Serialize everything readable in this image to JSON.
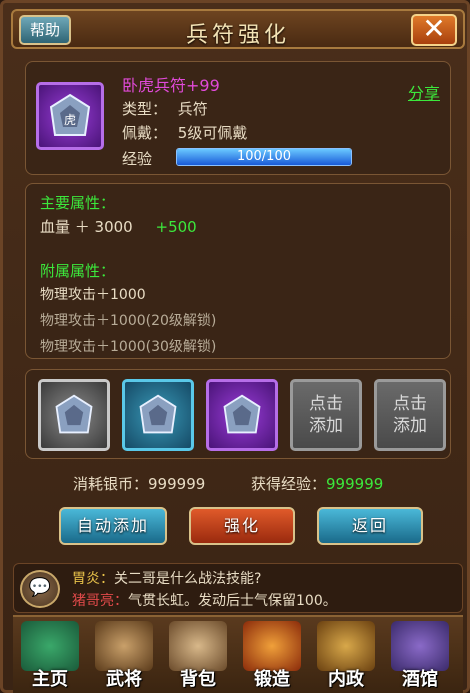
{
  "header": {
    "title": "兵符强化",
    "help_label": "帮助",
    "close_label": "✕"
  },
  "item": {
    "name": "卧虎兵符+99",
    "share_label": "分享",
    "type_label": "类型：",
    "type_value": "兵符",
    "wear_label": "佩戴：",
    "wear_value": "5级可佩戴",
    "exp_label": "经验",
    "exp_text": "100/100",
    "exp_progress": 1.0
  },
  "attributes": {
    "main_title": "主要属性：",
    "main_line": "血量 ＋ 3000",
    "main_bonus": "+500",
    "sub_title": "附属属性：",
    "sub_lines": [
      "物理攻击＋1000",
      "物理攻击＋1000(20级解锁)",
      "物理攻击＋1000(30级解锁)"
    ]
  },
  "materials": {
    "slots": [
      {
        "rarity": "grey"
      },
      {
        "rarity": "blue"
      },
      {
        "rarity": "purple"
      },
      {
        "rarity": "empty",
        "label_1": "点击",
        "label_2": "添加"
      },
      {
        "rarity": "empty",
        "label_1": "点击",
        "label_2": "添加"
      }
    ]
  },
  "costs": {
    "silver_label": "消耗银币：",
    "silver_value": "999999",
    "exp_label": "获得经验：",
    "exp_value": "999999"
  },
  "actions": {
    "auto_add": "自动添加",
    "enhance": "强化",
    "back": "返回"
  },
  "chat": [
    {
      "name": "胃炎：",
      "text": "关二哥是什么战法技能?"
    },
    {
      "name": "猪哥亮：",
      "text": "气贯长虹。发动后士气保留100。"
    }
  ],
  "nav": [
    "主页",
    "武将",
    "背包",
    "锻造",
    "内政",
    "酒馆"
  ],
  "colors": {
    "name_pink": "#e04ad8",
    "green": "#3ce83c",
    "gold": "#e8c24a"
  }
}
